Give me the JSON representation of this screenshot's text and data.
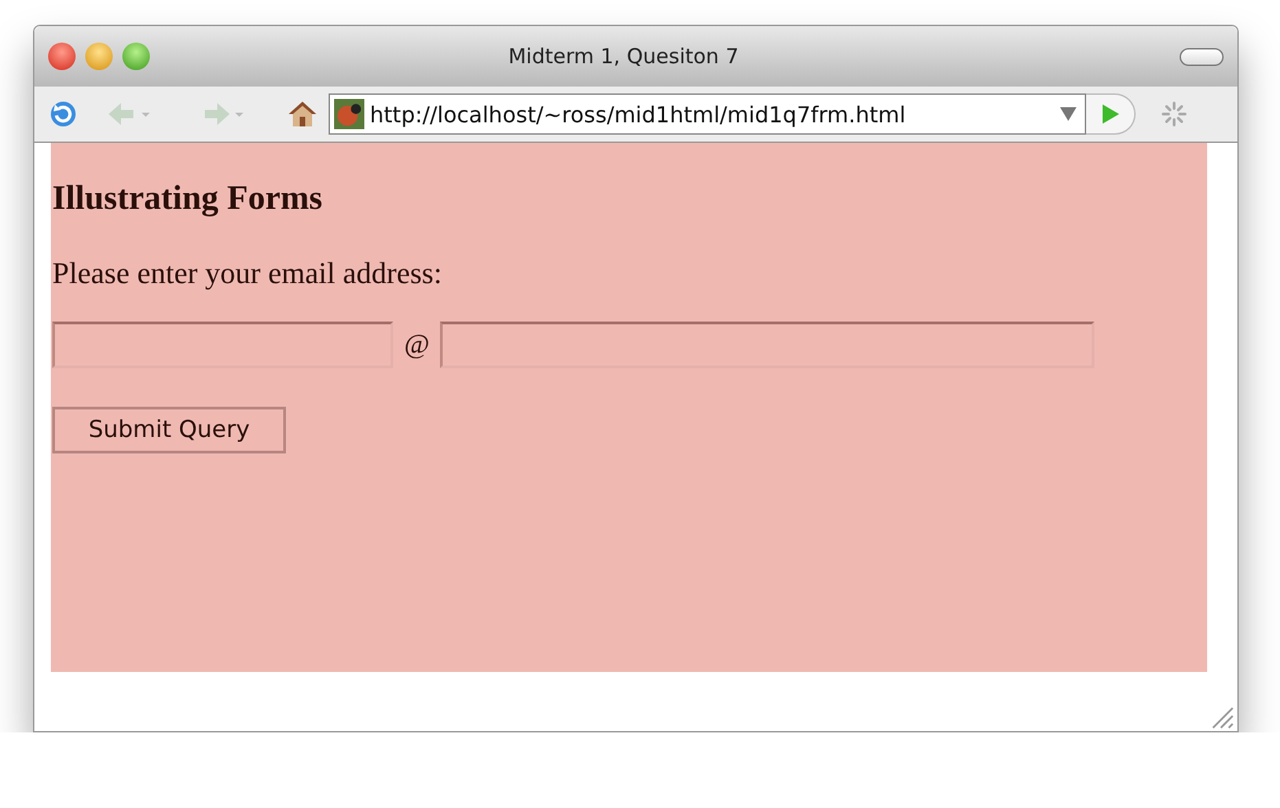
{
  "window": {
    "title": "Midterm 1, Quesiton 7"
  },
  "toolbar": {
    "url": "http://localhost/~ross/mid1html/mid1q7frm.html"
  },
  "page": {
    "heading": "Illustrating Forms",
    "prompt": "Please enter your email address:",
    "separator": "@",
    "submit": "Submit Query"
  }
}
